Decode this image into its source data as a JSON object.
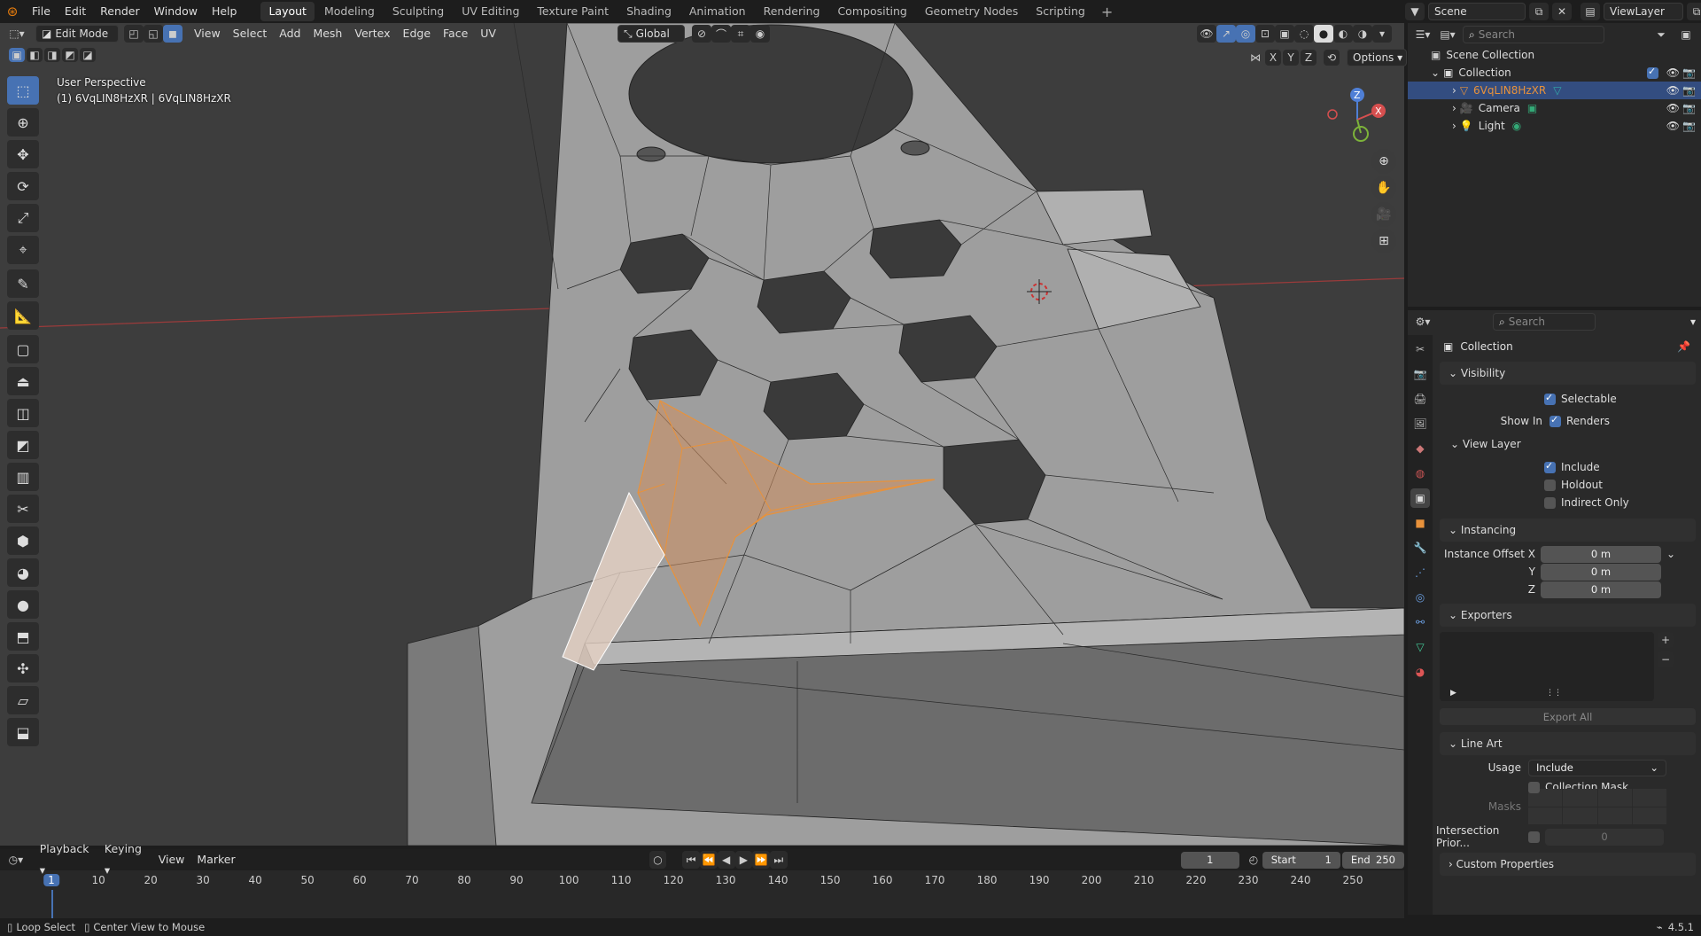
{
  "topbar": {
    "menus": [
      "File",
      "Edit",
      "Render",
      "Window",
      "Help"
    ],
    "workspaces": [
      "Layout",
      "Modeling",
      "Sculpting",
      "UV Editing",
      "Texture Paint",
      "Shading",
      "Animation",
      "Rendering",
      "Compositing",
      "Geometry Nodes",
      "Scripting"
    ],
    "active_workspace": "Layout",
    "scene": "Scene",
    "view_layer": "ViewLayer"
  },
  "viewport_header": {
    "mode": "Edit Mode",
    "menus": [
      "View",
      "Select",
      "Add",
      "Mesh",
      "Vertex",
      "Edge",
      "Face",
      "UV"
    ],
    "orientation": "Global",
    "axes": [
      "X",
      "Y",
      "Z"
    ],
    "options": "Options"
  },
  "viewport_overlay": {
    "perspective": "User Perspective",
    "object_info": "(1) 6VqLIN8HzXR | 6VqLIN8HzXR",
    "gizmo": {
      "x": "X",
      "y": "Y",
      "z": "Z"
    }
  },
  "outliner": {
    "search_placeholder": "Search",
    "root": "Scene Collection",
    "collection": "Collection",
    "items": [
      {
        "name": "6VqLIN8HzXR",
        "selected": true
      },
      {
        "name": "Camera",
        "selected": false
      },
      {
        "name": "Light",
        "selected": false
      }
    ]
  },
  "properties": {
    "search_placeholder": "Search",
    "title": "Collection",
    "visibility": {
      "header": "Visibility",
      "selectable": "Selectable",
      "show_in": "Show In",
      "renders": "Renders",
      "view_layer": "View Layer",
      "include": "Include",
      "holdout": "Holdout",
      "indirect_only": "Indirect Only"
    },
    "instancing": {
      "header": "Instancing",
      "offset_x_label": "Instance Offset X",
      "y_label": "Y",
      "z_label": "Z",
      "x": "0 m",
      "y": "0 m",
      "z": "0 m"
    },
    "exporters": {
      "header": "Exporters",
      "export_all": "Export All"
    },
    "line_art": {
      "header": "Line Art",
      "usage_label": "Usage",
      "usage_value": "Include",
      "collection_mask": "Collection Mask",
      "masks": "Masks",
      "intersection_label": "Intersection Prior...",
      "intersection_value": "0"
    },
    "custom_properties": "Custom Properties"
  },
  "timeline": {
    "menus": [
      "Playback",
      "Keying",
      "View",
      "Marker"
    ],
    "current_frame": "1",
    "start_label": "Start",
    "start": "1",
    "end_label": "End",
    "end": "250",
    "ticks": [
      "1",
      "10",
      "20",
      "30",
      "40",
      "50",
      "60",
      "70",
      "80",
      "90",
      "100",
      "110",
      "120",
      "130",
      "140",
      "150",
      "160",
      "170",
      "180",
      "190",
      "200",
      "210",
      "220",
      "230",
      "240",
      "250"
    ]
  },
  "statusbar": {
    "loop_select": "Loop Select",
    "center_view": "Center View to Mouse",
    "version": "4.5.1"
  },
  "colors": {
    "accent": "#4772b3",
    "selection": "#e8a060",
    "object_orange": "#e8923b"
  }
}
